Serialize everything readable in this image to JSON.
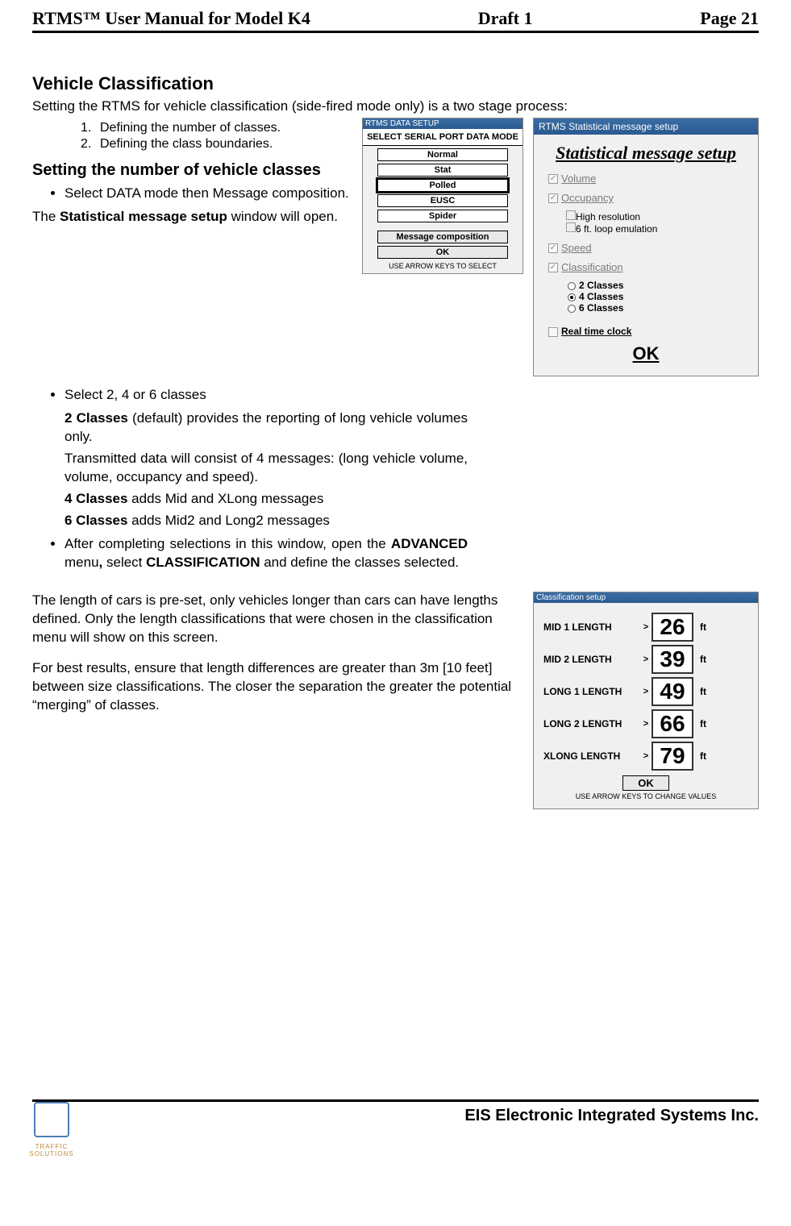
{
  "header": {
    "left": "RTMS™  User Manual for Model K4",
    "mid": "Draft 1",
    "right": "Page 21"
  },
  "s1": {
    "title": "Vehicle Classification",
    "intro": "Setting the RTMS for vehicle classification (side-fired mode only) is a two stage process:",
    "step1": "Defining the number of classes.",
    "step2": "Defining the class boundaries."
  },
  "s2": {
    "title": "Setting the number of vehicle classes",
    "b1": "Select DATA mode then Message composition.",
    "p1a": "The ",
    "p1b": "Statistical message setup",
    "p1c": " window will open.",
    "b2": "Select 2, 4 or 6 classes",
    "c2a": "2 Classes",
    "c2b": " (default) provides the reporting of long vehicle volumes only.",
    "c2c": "Transmitted data will consist of 4 messages: (long vehicle volume, volume, occupancy and speed).",
    "c4a": "4 Classes",
    "c4b": " adds Mid and XLong messages",
    "c6a": "6 Classes",
    "c6b": " adds Mid2 and Long2 messages",
    "b3a": "After completing selections in this window, open the ",
    "b3b": "ADVANCED",
    "b3c": " menu",
    "b3d": ", ",
    "b3e": "select ",
    "b3f": "CLASSIFICATION",
    "b3g": " and define the classes selected."
  },
  "s3": {
    "p1": "The length of cars is pre-set, only vehicles longer than cars can have lengths defined.  Only the length classifications that were chosen in the classification menu will show on this screen.",
    "p2": "For best results, ensure that length differences are greater than 3m [10 feet] between size classifications. The closer the separation the greater the potential “merging” of classes."
  },
  "dlg1": {
    "tb": "RTMS DATA SETUP",
    "hdr": "SELECT SERIAL PORT DATA MODE",
    "o1": "Normal",
    "o2": "Stat",
    "o3": "Polled",
    "o4": "EUSC",
    "o5": "Spider",
    "btn1": "Message composition",
    "btn2": "OK",
    "foot": "USE ARROW KEYS TO SELECT"
  },
  "dlg2": {
    "tb": "RTMS Statistical message setup",
    "title": "Statistical message setup",
    "volume": "Volume",
    "occupancy": "Occupancy",
    "hires": "High resolution",
    "loop": "6 ft. loop emulation",
    "speed": "Speed",
    "classification": "Classification",
    "r1": "2 Classes",
    "r2": "4 Classes",
    "r3": "6 Classes",
    "rtc": "Real time clock",
    "ok": "OK"
  },
  "dlg3": {
    "tb": "Classification setup",
    "rows": [
      {
        "name": "MID 1 LENGTH",
        "val": "26",
        "unit": "ft"
      },
      {
        "name": "MID 2 LENGTH",
        "val": "39",
        "unit": "ft"
      },
      {
        "name": "LONG 1 LENGTH",
        "val": "49",
        "unit": "ft"
      },
      {
        "name": "LONG 2 LENGTH",
        "val": "66",
        "unit": "ft"
      },
      {
        "name": "XLONG LENGTH",
        "val": "79",
        "unit": "ft"
      }
    ],
    "gt": ">",
    "ok": "OK",
    "foot": "USE ARROW KEYS TO CHANGE VALUES"
  },
  "footer": {
    "company": "EIS Electronic Integrated Systems Inc.",
    "logocap": "TRAFFIC SOLUTIONS"
  }
}
